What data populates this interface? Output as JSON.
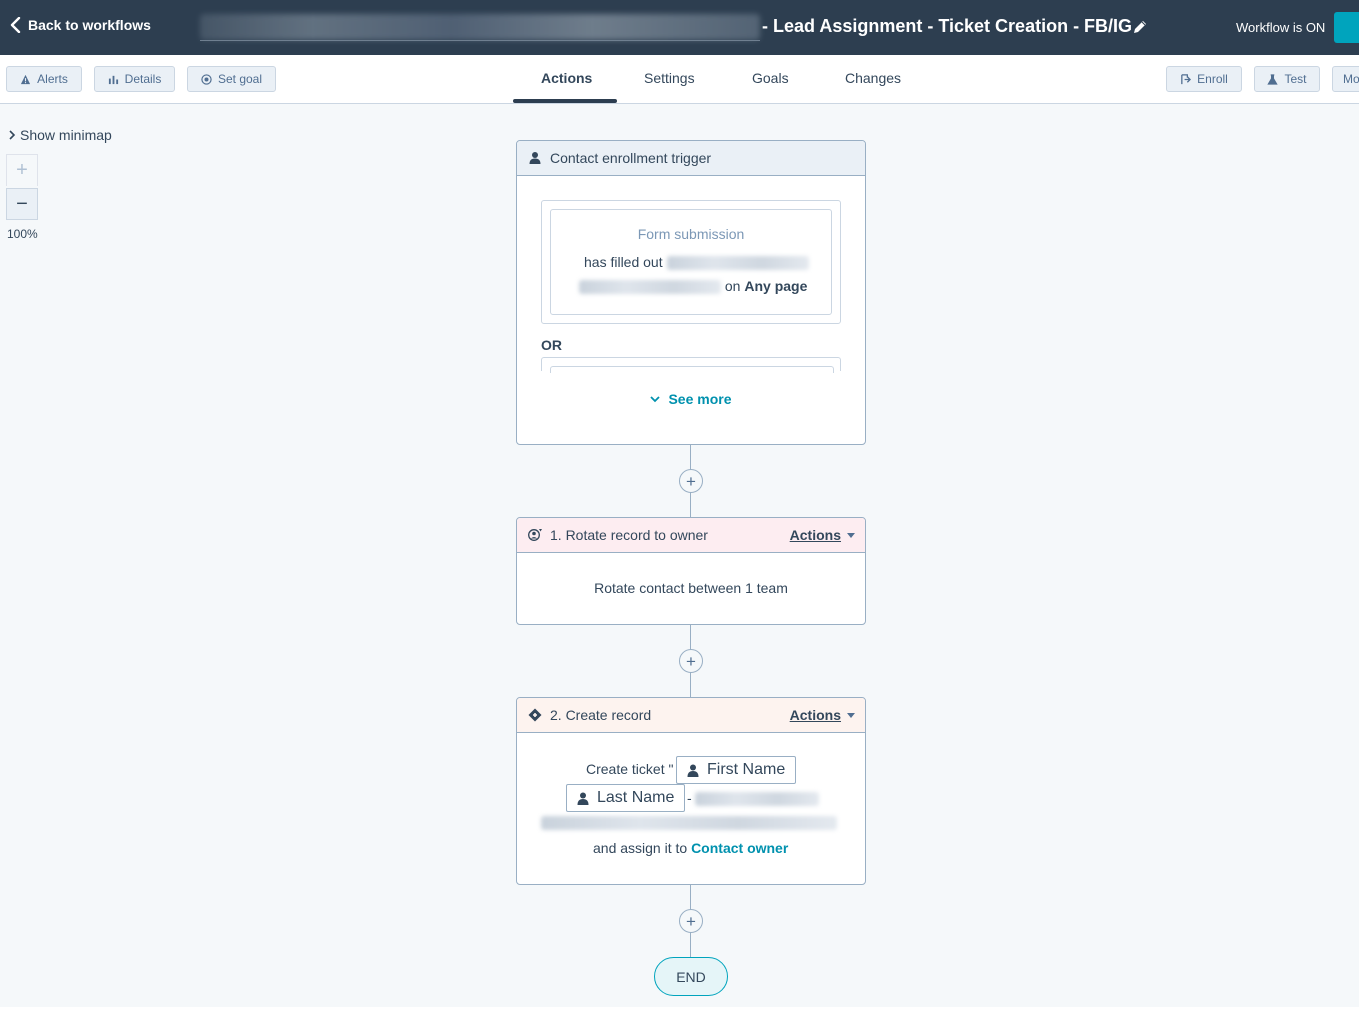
{
  "header": {
    "back_label": "Back to workflows",
    "title_suffix": "- Lead Assignment - Ticket Creation - FB/IG",
    "status": "Workflow is ON",
    "icons": {
      "back": "chevron-left-icon",
      "edit": "pencil-icon"
    }
  },
  "toolbar": {
    "alerts": "Alerts",
    "details": "Details",
    "set_goal": "Set goal",
    "enroll": "Enroll",
    "test": "Test",
    "more": "Mo"
  },
  "tabs": [
    {
      "label": "Actions",
      "active": true
    },
    {
      "label": "Settings",
      "active": false
    },
    {
      "label": "Goals",
      "active": false
    },
    {
      "label": "Changes",
      "active": false
    }
  ],
  "canvas": {
    "minimap_label": "Show minimap",
    "zoom_in": "+",
    "zoom_out": "−",
    "zoom_level": "100%"
  },
  "trigger": {
    "title": "Contact enrollment trigger",
    "filter_type": "Form submission",
    "filled_label": "has filled out",
    "on_label": "on",
    "page_value": "Any page",
    "or_label": "OR",
    "see_more": "See more"
  },
  "step1": {
    "title": "1. Rotate record to owner",
    "actions_label": "Actions",
    "body": "Rotate contact between 1 team"
  },
  "step2": {
    "title": "2. Create record",
    "actions_label": "Actions",
    "create_prefix": "Create ticket \"",
    "token_first": "First Name",
    "token_last": "Last Name",
    "dash": "-",
    "assign_prefix": "and assign it to",
    "assign_link": "Contact owner"
  },
  "connector_plus": "+",
  "end_label": "END",
  "colors": {
    "header_bg": "#2d3e50",
    "accent": "#00a4bd",
    "link": "#0091ae",
    "trigger_head": "#eaf0f6",
    "rotate_head": "#fdedf1",
    "create_head": "#fdf3ef"
  }
}
